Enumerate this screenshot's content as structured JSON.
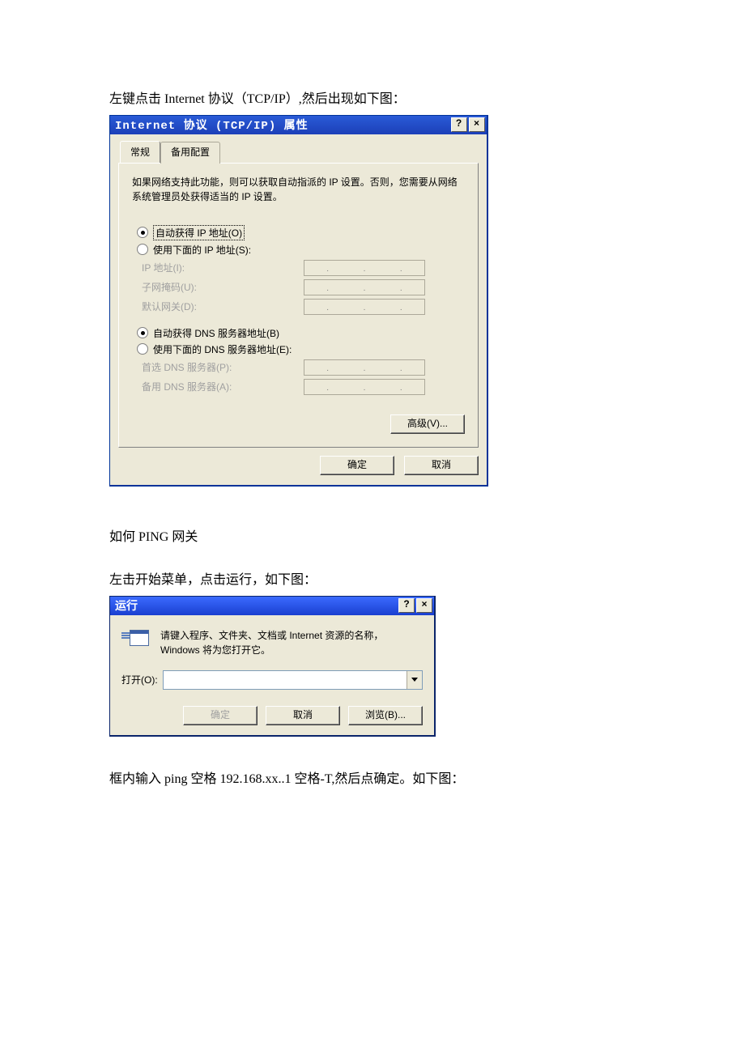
{
  "doc": {
    "intro1_pre": "左键点击 Internet 协议（",
    "intro1_mono": "TCP/IP",
    "intro1_post": "）,然后出现如下图：",
    "section2": "如何 PING  网关",
    "section2b": "左击开始菜单，点击运行，如下图：",
    "outro": "框内输入 ping  空格 192.168.xx..1  空格-T,然后点确定。如下图："
  },
  "tcpip": {
    "title": "Internet 协议 (TCP/IP) 属性",
    "help_btn": "?",
    "close_btn": "×",
    "tab_general": "常规",
    "tab_alt": "备用配置",
    "help": "如果网络支持此功能，则可以获取自动指派的 IP 设置。否则，您需要从网络系统管理员处获得适当的 IP 设置。",
    "r_auto_ip": "自动获得 IP 地址(O)",
    "r_use_ip": "使用下面的 IP 地址(S):",
    "f_ip": "IP 地址(I):",
    "f_mask": "子网掩码(U):",
    "f_gw": "默认网关(D):",
    "r_auto_dns": "自动获得 DNS 服务器地址(B)",
    "r_use_dns": "使用下面的 DNS 服务器地址(E):",
    "f_dns1": "首选 DNS 服务器(P):",
    "f_dns2": "备用 DNS 服务器(A):",
    "btn_adv": "高级(V)...",
    "btn_ok": "确定",
    "btn_cancel": "取消"
  },
  "run": {
    "title": "运行",
    "help_btn": "?",
    "close_btn": "×",
    "help": "请键入程序、文件夹、文档或 Internet 资源的名称，Windows 将为您打开它。",
    "open_label": "打开(O):",
    "input_value": "",
    "btn_ok": "确定",
    "btn_cancel": "取消",
    "btn_browse": "浏览(B)..."
  }
}
